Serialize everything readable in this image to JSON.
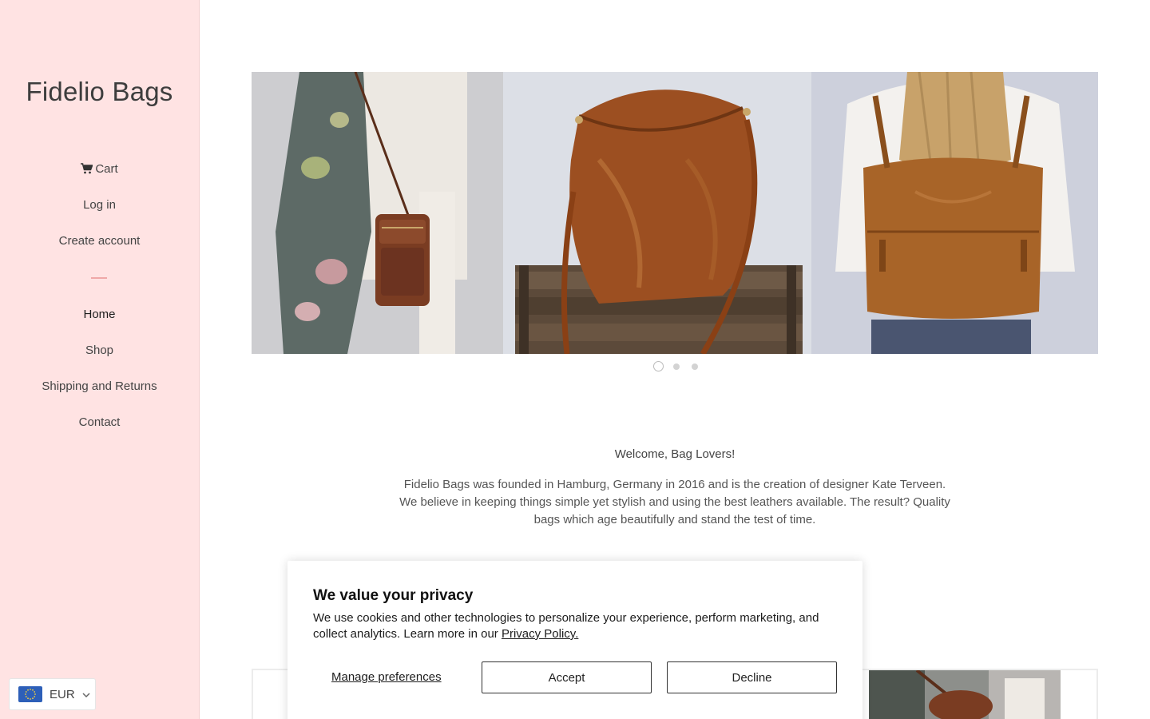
{
  "sidebar": {
    "brand": "Fidelio Bags",
    "account_links": {
      "cart": "Cart",
      "login": "Log in",
      "create_account": "Create account"
    },
    "nav": {
      "home": "Home",
      "shop": "Shop",
      "shipping": "Shipping and Returns",
      "contact": "Contact"
    },
    "currency": {
      "code": "EUR",
      "icon": "eu-flag-icon"
    },
    "background_color": "#ffe3e3",
    "divider_color": "#f0a8a8"
  },
  "slideshow": {
    "slide_count": 3,
    "active_slide": 1
  },
  "welcome": {
    "title": "Welcome, Bag Lovers!",
    "body": "Fidelio Bags was founded in Hamburg, Germany in 2016 and is the creation of designer Kate Terveen. We believe in keeping things simple yet stylish and using the best leathers available. The result? Quality bags which age beautifully and stand the test of time."
  },
  "cookie_banner": {
    "title": "We value your privacy",
    "text": "We use cookies and other technologies to personalize your experience, perform marketing, and collect analytics. Learn more in our",
    "policy_link": "Privacy Policy.",
    "manage_label": "Manage preferences",
    "accept_label": "Accept",
    "decline_label": "Decline"
  }
}
